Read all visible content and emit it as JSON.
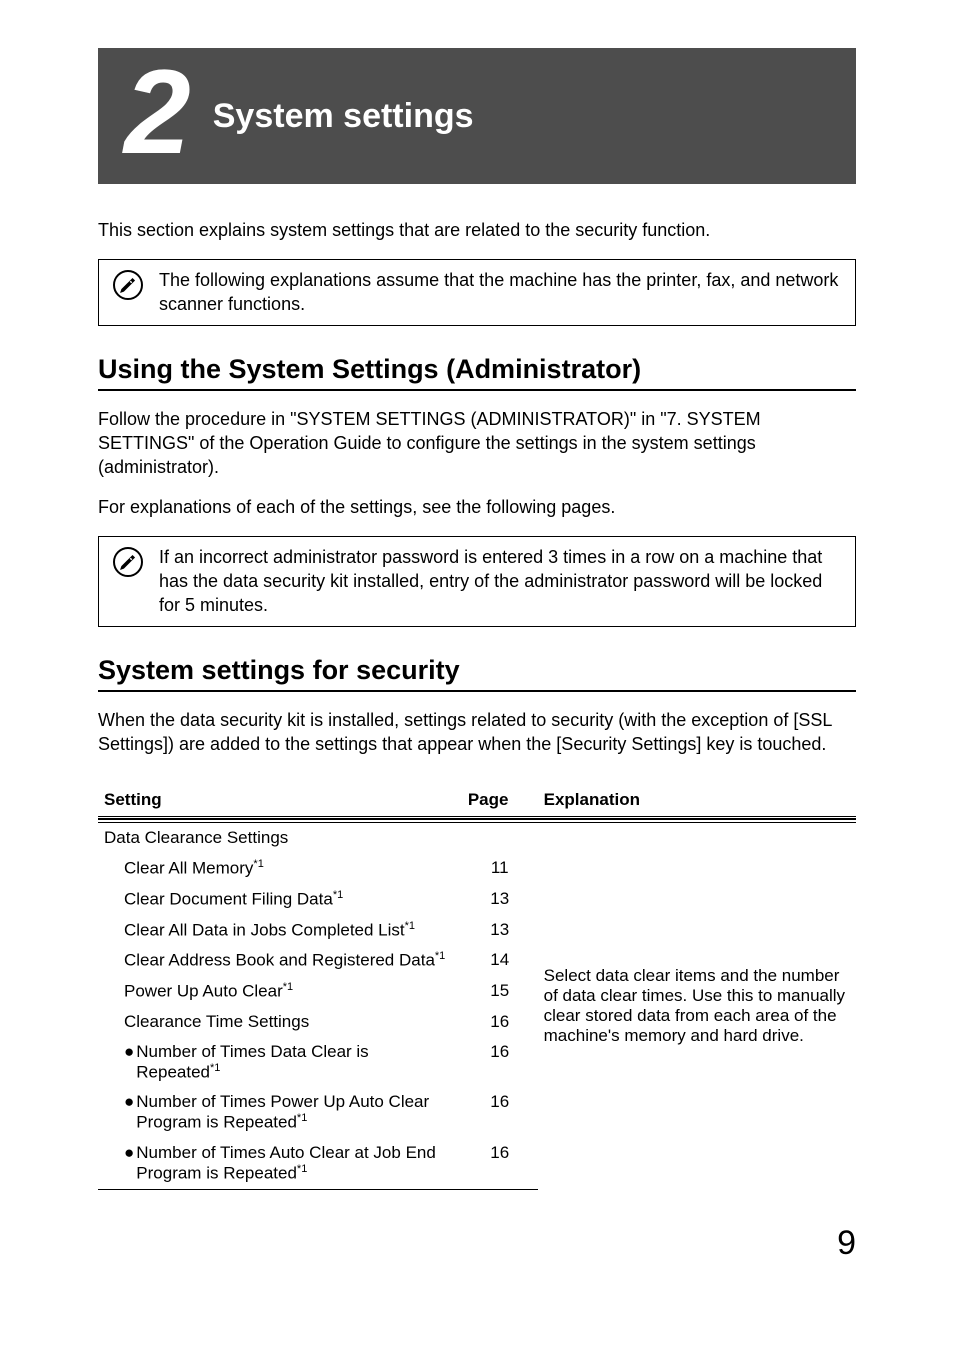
{
  "chapter": {
    "number": "2",
    "title": "System settings"
  },
  "intro": "This section explains system settings that are related to the security function.",
  "note1": "The following explanations assume that the machine has the printer, fax, and network scanner functions.",
  "section1": {
    "heading": "Using the System Settings (Administrator)",
    "p1": "Follow the procedure in \"SYSTEM SETTINGS (ADMINISTRATOR)\" in \"7. SYSTEM SETTINGS\" of the Operation Guide to configure the settings in the system settings (administrator).",
    "p2": "For explanations of each of the settings, see the following pages."
  },
  "note2": "If an incorrect administrator password is entered 3 times in a row on a machine that has the data security kit installed, entry of the administrator password will be locked for 5 minutes.",
  "section2": {
    "heading": "System settings for security",
    "p1": "When the data security kit is installed, settings related to security (with the exception of [SSL Settings]) are added to the settings that appear when the [Security Settings] key is touched."
  },
  "table": {
    "headers": {
      "setting": "Setting",
      "page": "Page",
      "explanation": "Explanation"
    },
    "rows": [
      {
        "setting": "Data Clearance Settings",
        "page": "",
        "indent": 0
      },
      {
        "setting": "Clear All Memory",
        "sup": "*1",
        "page": "11",
        "indent": 1
      },
      {
        "setting": "Clear Document Filing Data",
        "sup": "*1",
        "page": "13",
        "indent": 1
      },
      {
        "setting": "Clear All Data in Jobs Completed List",
        "sup": "*1",
        "page": "13",
        "indent": 1
      },
      {
        "setting": "Clear Address Book and Registered Data",
        "sup": "*1",
        "page": "14",
        "indent": 1
      },
      {
        "setting": "Power Up Auto Clear",
        "sup": "*1",
        "page": "15",
        "indent": 1
      },
      {
        "setting": "Clearance Time Settings",
        "page": "16",
        "indent": 1
      },
      {
        "setting": "Number of Times Data Clear is Repeated",
        "sup": "*1",
        "page": "16",
        "indent": 1,
        "bullet": true
      },
      {
        "setting": "Number of Times Power Up Auto Clear Program is Repeated",
        "sup": "*1",
        "page": "16",
        "indent": 1,
        "bullet": true
      },
      {
        "setting": "Number of Times Auto Clear at Job End Program is Repeated",
        "sup": "*1",
        "page": "16",
        "indent": 1,
        "bullet": true
      }
    ],
    "explanation": "Select data clear items and the number of data clear times. Use this to manually clear stored data from each area of the machine's memory and hard drive."
  },
  "pageNumber": "9",
  "icons": {
    "pencil": "pencil-icon",
    "bullet": "●"
  }
}
